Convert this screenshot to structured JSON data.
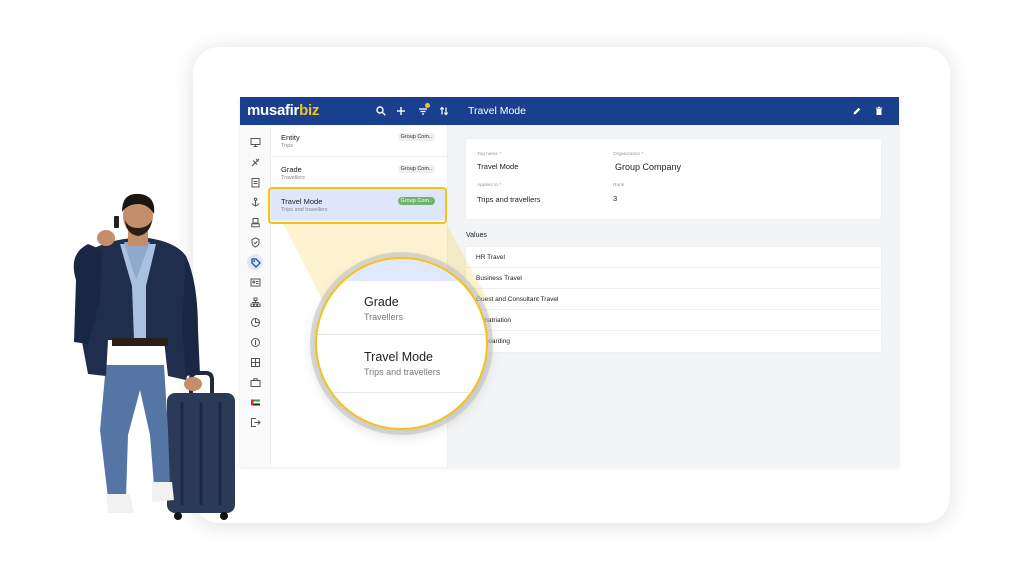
{
  "app": {
    "logo": {
      "part1": "musafir",
      "part2": "biz"
    },
    "title": "Travel Mode",
    "colors": {
      "topbar": "#1b3f8f",
      "accent": "#f5c21b",
      "badge_selected": "#6db56d",
      "selected_row": "#dde6fb"
    }
  },
  "toolbar": {
    "icons": [
      "search-icon",
      "plus-icon",
      "filter-icon",
      "sort-icon"
    ],
    "actions": [
      "edit-icon",
      "delete-icon"
    ]
  },
  "rail": {
    "icons": [
      "monitor-icon",
      "plane-icon",
      "clipboard-icon",
      "anchor-icon",
      "building-icon",
      "shield-icon",
      "tag-icon",
      "id-card-icon",
      "org-chart-icon",
      "pie-chart-icon",
      "coin-icon",
      "grid-icon",
      "briefcase-icon",
      "flag-icon",
      "logout-icon"
    ],
    "active_index": 6
  },
  "list": {
    "items": [
      {
        "title": "Entity",
        "subtitle": "Trips",
        "badge": "Group Com.."
      },
      {
        "title": "Grade",
        "subtitle": "Travellers",
        "badge": "Group Com.."
      },
      {
        "title": "Travel Mode",
        "subtitle": "Trips and travellers",
        "badge": "Group Com.."
      }
    ],
    "selected_index": 2
  },
  "details": {
    "tag_name_label": "Tag name *",
    "tag_name": "Travel Mode",
    "organization_label": "Organization *",
    "organization": "Group Company",
    "applies_to_label": "Applies to *",
    "applies_to": "Trips and travellers",
    "rank_label": "Rank",
    "rank": "3"
  },
  "values": {
    "heading": "Values",
    "items": [
      "HR Travel",
      "Business Travel",
      "Guest and Consultant Travel",
      "Repatriation",
      "Onboarding"
    ]
  },
  "magnifier": {
    "items": [
      {
        "title": "Grade",
        "subtitle": "Travellers"
      },
      {
        "title": "Travel Mode",
        "subtitle": "Trips and travellers"
      }
    ]
  }
}
